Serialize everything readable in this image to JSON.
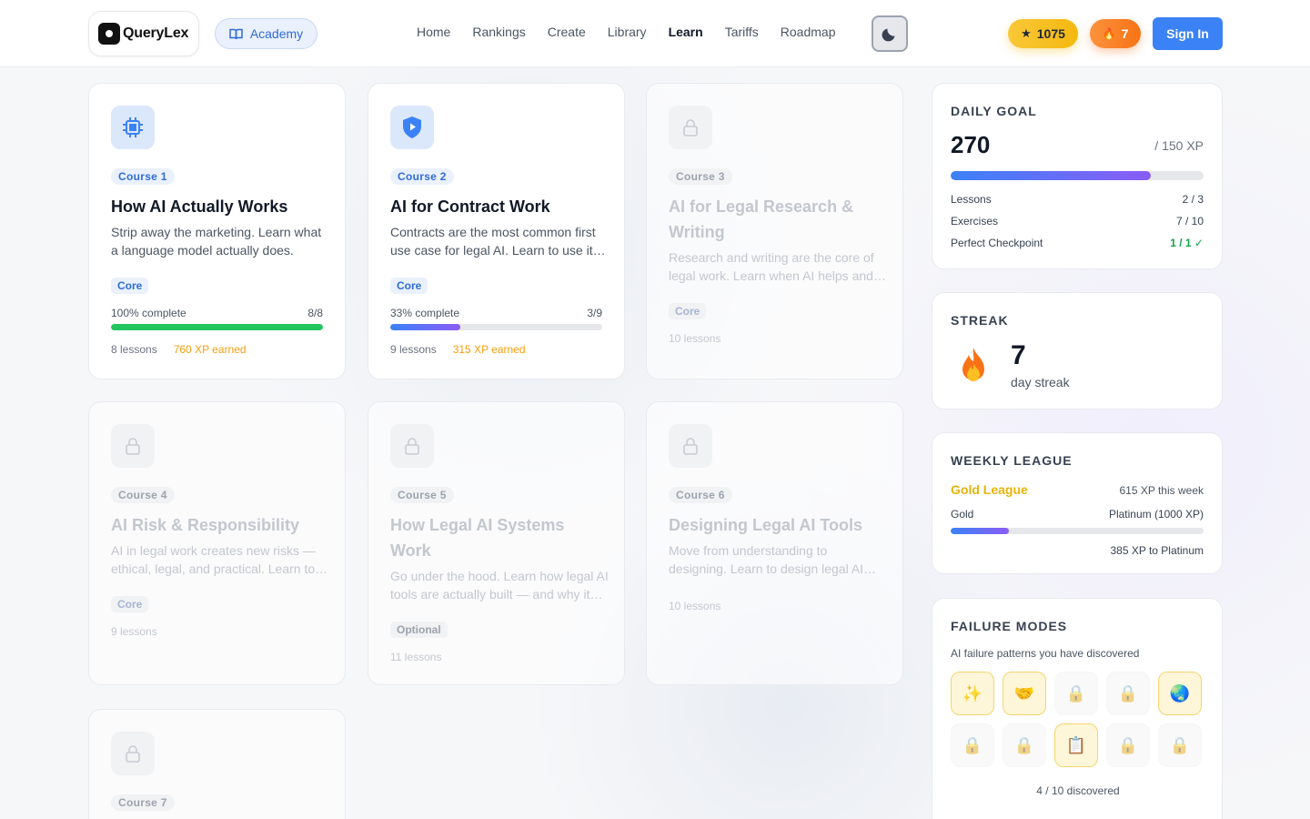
{
  "header": {
    "logo_text": "QueryLex",
    "academy_label": "Academy",
    "nav": [
      "Home",
      "Rankings",
      "Create",
      "Library",
      "Learn",
      "Tariffs",
      "Roadmap"
    ],
    "active_nav": "Learn",
    "xp_count": "1075",
    "streak_count": "7",
    "signin_label": "Sign In"
  },
  "courses": [
    {
      "tag": "Course 1",
      "title": "How AI Actually Works",
      "desc": "Strip away the marketing. Learn what a language model actually does.",
      "tier": "Core",
      "progress_text": "100% complete",
      "progress_count": "8/8",
      "progress": 1.0,
      "lessons": "8 lessons",
      "xp": "760 XP earned",
      "locked": false
    },
    {
      "tag": "Course 2",
      "title": "AI for Contract Work",
      "desc": "Contracts are the most common first use case for legal AI. Learn to use it well.",
      "tier": "Core",
      "progress_text": "33% complete",
      "progress_count": "3/9",
      "progress": 0.33,
      "lessons": "9 lessons",
      "xp": "315 XP earned",
      "locked": false
    },
    {
      "tag": "Course 3",
      "title": "AI for Legal Research & Writing",
      "desc": "Research and writing are the core of legal work. Learn when AI helps and when it hurts.",
      "tier": "Core",
      "lessons": "10 lessons",
      "locked": true
    },
    {
      "tag": "Course 4",
      "title": "AI Risk & Responsibility",
      "desc": "AI in legal work creates new risks — ethical, legal, and practical. Learn to manage them.",
      "tier": "Core",
      "lessons": "9 lessons",
      "locked": true
    },
    {
      "tag": "Course 5",
      "title": "How Legal AI Systems Work",
      "desc": "Go under the hood. Learn how legal AI tools are actually built — and why it matters.",
      "tier": "Optional",
      "lessons": "11 lessons",
      "locked": true
    },
    {
      "tag": "Course 6",
      "title": "Designing Legal AI Tools",
      "desc": "Move from understanding to designing. Learn to design legal AI tools that work.",
      "lessons": "10 lessons",
      "locked": true
    },
    {
      "tag": "Course 7",
      "locked": true
    }
  ],
  "daily_goal": {
    "title": "DAILY GOAL",
    "xp": "270",
    "target": "/ 150 XP",
    "progress": 0.79,
    "rows": [
      {
        "label": "Lessons",
        "value": "2 / 3"
      },
      {
        "label": "Exercises",
        "value": "7 / 10"
      },
      {
        "label": "Perfect Checkpoint",
        "value": "1 / 1 ✓"
      }
    ]
  },
  "streak": {
    "title": "STREAK",
    "days": "7",
    "label": "day streak"
  },
  "league": {
    "title": "WEEKLY LEAGUE",
    "name": "Gold League",
    "xp_week": "615 XP this week",
    "current": "Gold",
    "next": "Platinum (1000 XP)",
    "progress": 0.23,
    "to_next": "385 XP to Platinum"
  },
  "failure_modes": {
    "title": "FAILURE MODES",
    "subtitle": "AI failure patterns you have discovered",
    "badges": [
      "✨",
      "🤝",
      "🔒",
      "🔒",
      "🌏",
      "🔒",
      "🔒",
      "📋",
      "🔒",
      "🔒"
    ],
    "found": [
      true,
      true,
      false,
      false,
      true,
      false,
      false,
      true,
      false,
      false
    ],
    "count": "4 / 10 discovered"
  },
  "colors": {
    "accent": "#3b82f6",
    "green": "#22c55e",
    "purple": "#8b5cf6",
    "gold": "#eab308",
    "xp_orange": "#f59e0b"
  }
}
